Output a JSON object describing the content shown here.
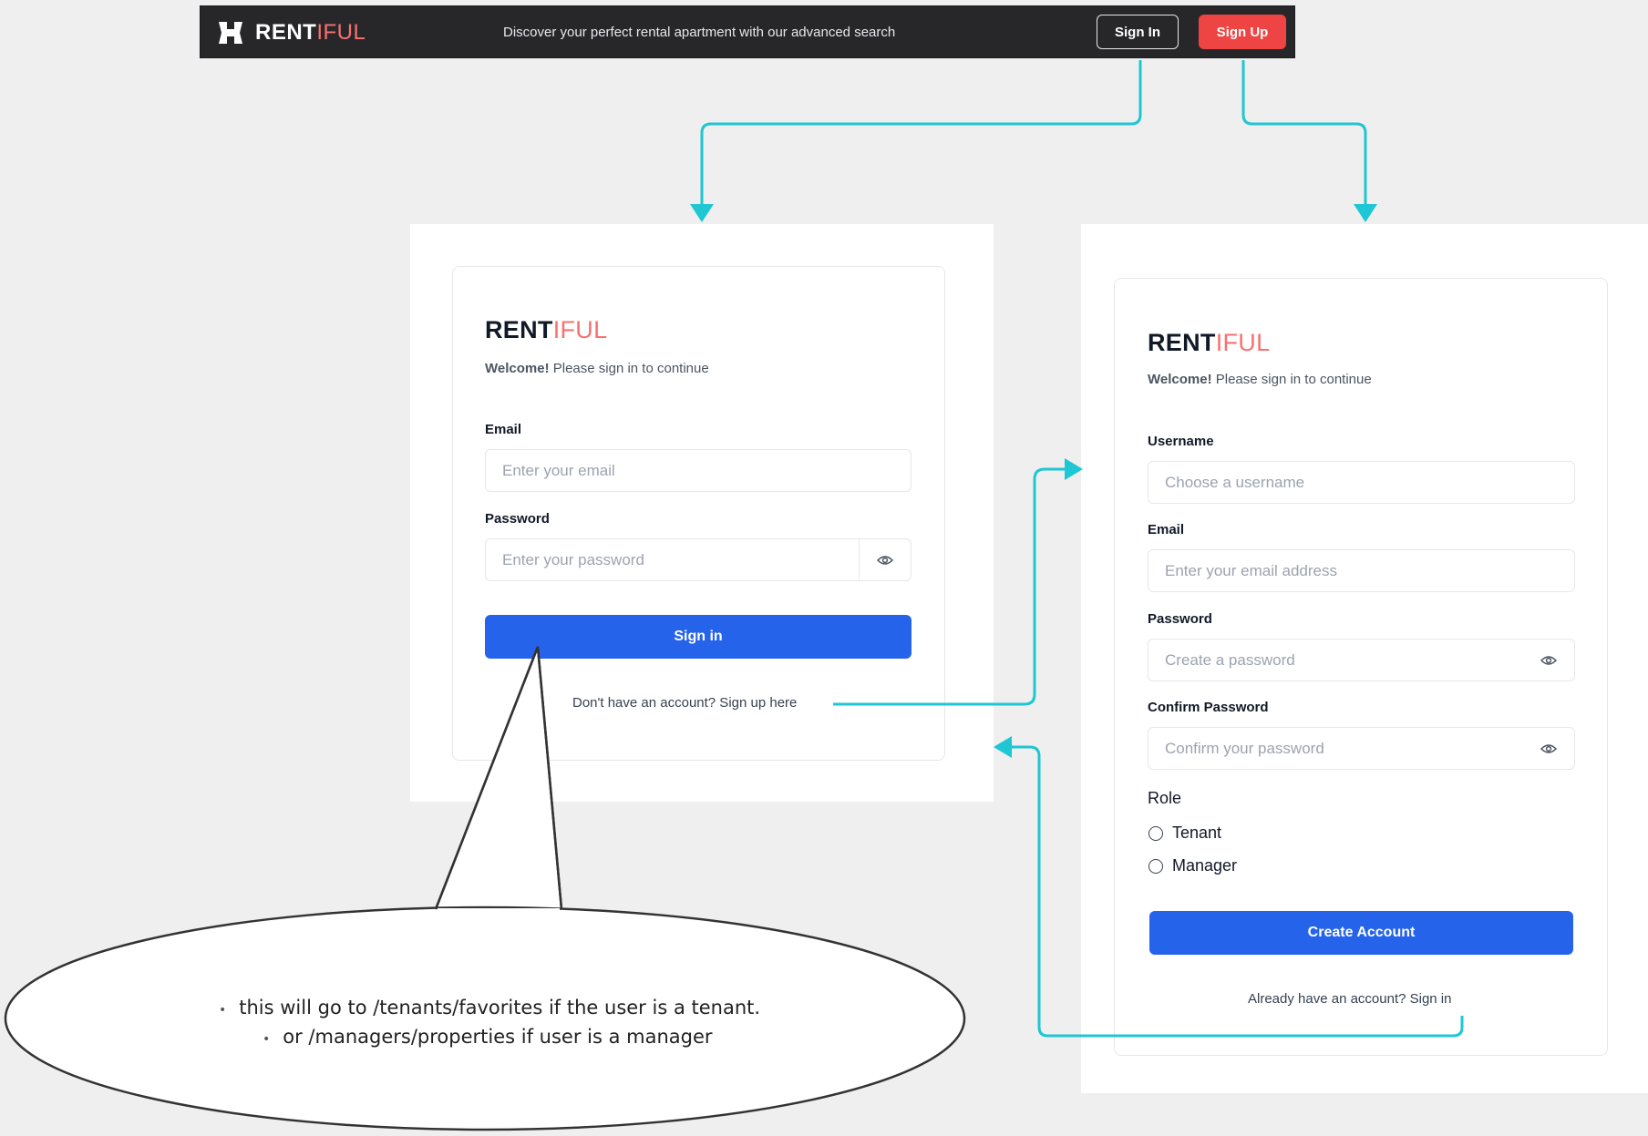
{
  "header": {
    "brand_bold": "RENT",
    "brand_light": "IFUL",
    "tagline": "Discover your perfect rental apartment with our advanced search",
    "signin_label": "Sign In",
    "signup_label": "Sign Up"
  },
  "signin_card": {
    "brand_bold": "RENT",
    "brand_light": "IFUL",
    "welcome_bold": "Welcome!",
    "welcome_rest": " Please sign in to continue",
    "email_label": "Email",
    "email_placeholder": "Enter your email",
    "password_label": "Password",
    "password_placeholder": "Enter your password",
    "submit_label": "Sign in",
    "signup_link": "Don't have an account? Sign up here"
  },
  "signup_card": {
    "brand_bold": "RENT",
    "brand_light": "IFUL",
    "welcome_bold": "Welcome!",
    "welcome_rest": " Please sign in to continue",
    "username_label": "Username",
    "username_placeholder": "Choose a username",
    "email_label": "Email",
    "email_placeholder": "Enter your email address",
    "password_label": "Password",
    "password_placeholder": "Create a password",
    "confirm_label": "Confirm Password",
    "confirm_placeholder": "Confirm your password",
    "role_label": "Role",
    "roles": [
      "Tenant",
      "Manager"
    ],
    "submit_label": "Create Account",
    "signin_link": "Already have an account? Sign in"
  },
  "callout": {
    "lines": [
      "this will go to /tenants/favorites if the user is a tenant.",
      "or /managers/properties if user is a manager"
    ]
  },
  "colors": {
    "arrow": "#1fc6d3",
    "accent": "#f87171",
    "primary": "#2563eb",
    "topbar": "#27272a"
  }
}
